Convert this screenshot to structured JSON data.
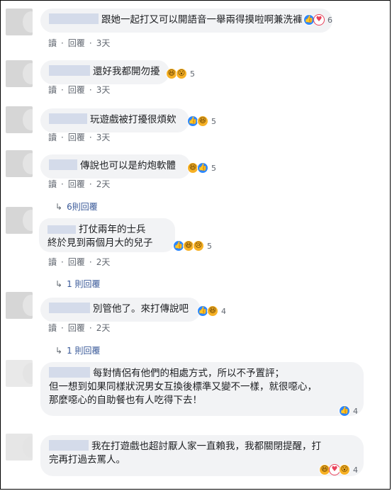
{
  "labels": {
    "reply": "讀",
    "respond": "回覆",
    "sep": "·"
  },
  "comments": [
    {
      "text": "跟她一起打又可以開語音一舉兩得摸啦啊兼洗褲",
      "reactions": [
        "like",
        "love"
      ],
      "count": "6",
      "time": "3天"
    },
    {
      "text": "還好我都開勿擾",
      "reactions": [
        "haha",
        "wow"
      ],
      "count": "5",
      "time": "3天"
    },
    {
      "text": "玩遊戲被打擾很煩欸",
      "reactions": [
        "like",
        "haha"
      ],
      "count": "5",
      "time": "3天"
    },
    {
      "text": "傳說也可以是約炮軟體",
      "reactions": [
        "haha",
        "like"
      ],
      "count": "5",
      "time": "2天",
      "replies": "6則回覆"
    },
    {
      "text1": "打仗兩年的士兵",
      "text2": "終於見到兩個月大的兒子",
      "reactions": [
        "like",
        "haha",
        "sad"
      ],
      "count": "5",
      "time": "2天",
      "replies": "1 則回覆"
    },
    {
      "text": "別管他了。來打傳說吧",
      "reactions": [
        "like",
        "haha"
      ],
      "count": "4",
      "time": "2天",
      "replies": "1 則回覆"
    },
    {
      "text1": "每對情侶有他們的相處方式，所以不予置評；",
      "text2": "但一想到如果同樣狀況男女互換後標準又變不一樣，就很噁心，",
      "text3": "那麼噁心的自助餐也有人吃得下去！",
      "reactions": [
        "like"
      ],
      "count": "4"
    },
    {
      "text1": "我在打遊戲也超討厭人家一直賴我，我都關閉提醒，打",
      "text2": "完再打過去罵人。",
      "reactions": [
        "haha",
        "love",
        "wow"
      ],
      "count": "4"
    }
  ]
}
